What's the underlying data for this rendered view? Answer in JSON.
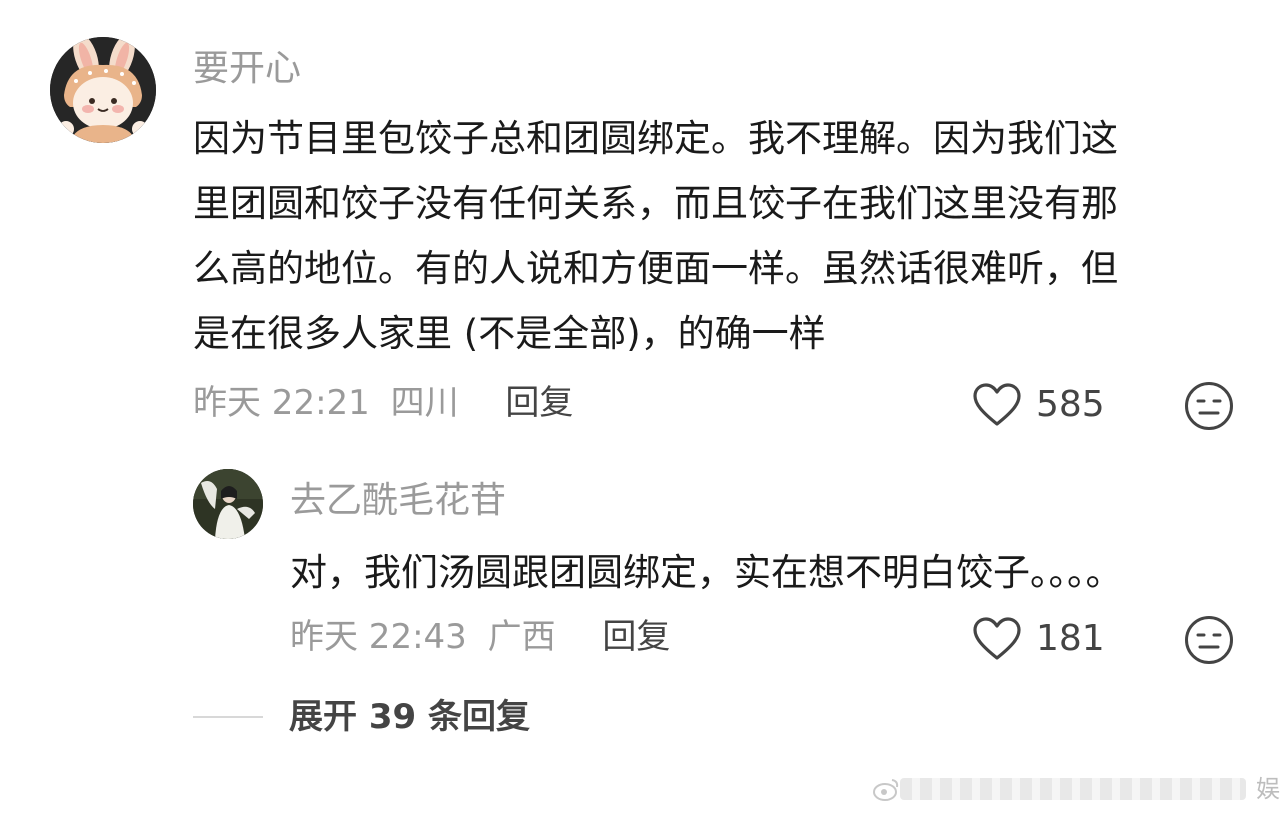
{
  "comment": {
    "avatar_icon": "bunny-avatar-icon",
    "username": "要开心",
    "lines": [
      "因为节目里包饺子总和团圆绑定。我不理解。因为我们这",
      "里团圆和饺子没有任何关系，而且饺子在我们这里没有那",
      "么高的地位。有的人说和方便面一样。虽然话很难听，但",
      "是在很多人家里 (不是全部)，的确一样"
    ],
    "time": "昨天 22:21",
    "location": "四川",
    "reply_label": "回复",
    "like_count": "585",
    "like_icon": "heart-outline-icon",
    "reaction_icon": "neutral-face-icon"
  },
  "reply": {
    "avatar_icon": "person-in-white-avatar-icon",
    "username": "去乙酰毛花苷",
    "text": "对，我们汤圆跟团圆绑定，实在想不明白饺子。。。。",
    "time": "昨天 22:43",
    "location": "广西",
    "reply_label": "回复",
    "like_count": "181",
    "like_icon": "heart-outline-icon",
    "reaction_icon": "neutral-face-icon"
  },
  "expand": {
    "label": "展开 39 条回复"
  },
  "watermark": {
    "text": "娱"
  },
  "colors": {
    "username": "#9a9a9a",
    "text": "#1a1a1a",
    "meta": "#9a9a9a",
    "action": "#444444"
  }
}
